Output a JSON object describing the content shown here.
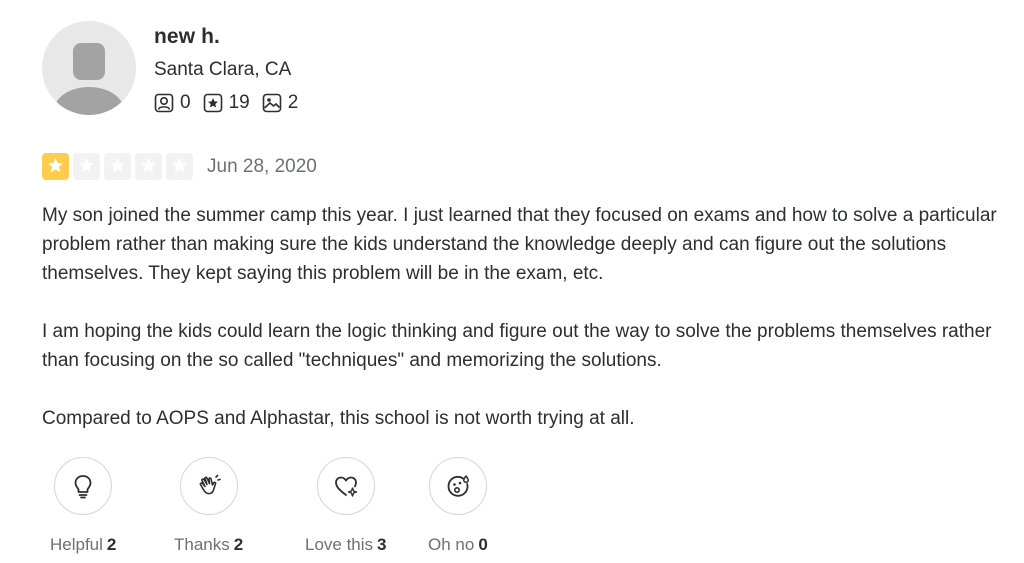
{
  "user": {
    "name": "new h.",
    "location": "Santa Clara, CA",
    "friends_count": "0",
    "reviews_count": "19",
    "photos_count": "2"
  },
  "review": {
    "rating": 1,
    "max_rating": 5,
    "date": "Jun 28, 2020",
    "paragraphs": [
      "My son joined the summer camp this year. I just learned that they focused on exams and how to solve a particular problem rather than making sure the kids understand the knowledge deeply and can figure out the solutions themselves. They kept saying this problem will be in the exam, etc.",
      "I am hoping the kids could learn the logic thinking and figure out the way to solve the problems themselves rather than focusing on the so called \"techniques\" and memorizing the solutions.",
      "Compared to AOPS and Alphastar, this school is not worth trying at all."
    ]
  },
  "reactions": [
    {
      "label": "Helpful",
      "count": "2",
      "icon": "lightbulb-icon"
    },
    {
      "label": "Thanks",
      "count": "2",
      "icon": "waving-hand-icon"
    },
    {
      "label": "Love this",
      "count": "3",
      "icon": "heart-sparkle-icon"
    },
    {
      "label": "Oh no",
      "count": "0",
      "icon": "surprised-face-icon"
    }
  ],
  "colors": {
    "star_filled": "#ffcc4b",
    "star_empty": "#f2f2f2",
    "text": "#2d2e2f",
    "muted": "#6e7072"
  }
}
